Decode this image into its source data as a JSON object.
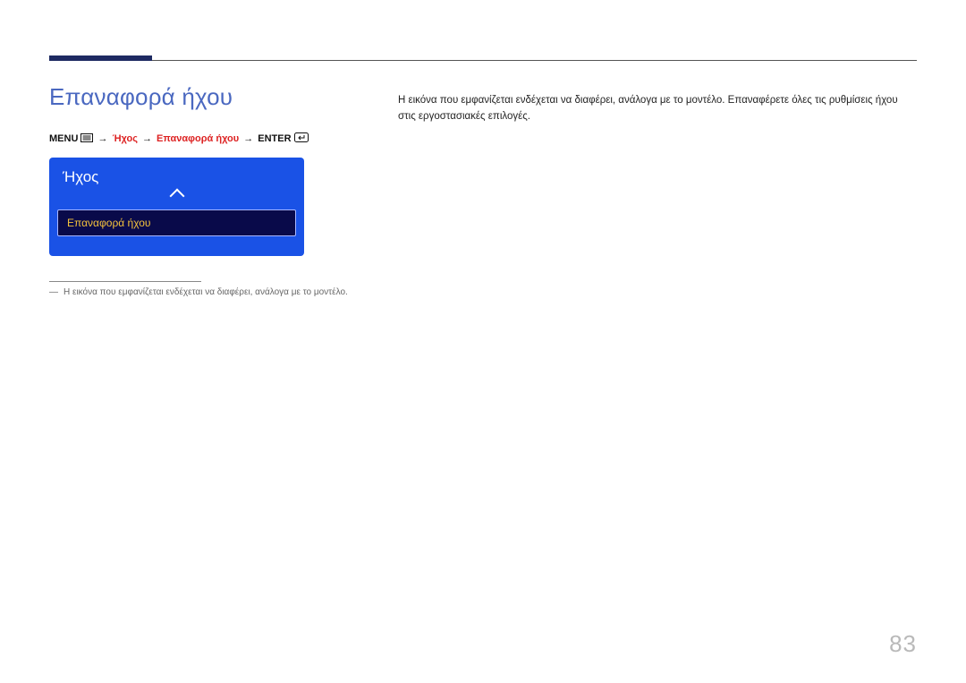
{
  "header": {},
  "section": {
    "title": "Επαναφορά ήχου"
  },
  "breadcrumb": {
    "menu_label": "MENU",
    "step2": "Ήχος",
    "step3": "Επαναφορά ήχου",
    "enter_label": "ENTER"
  },
  "osd": {
    "title": "Ήχος",
    "selected_item": "Επαναφορά ήχου"
  },
  "footnote": {
    "dash": "―",
    "text": "Η εικόνα που εμφανίζεται ενδέχεται να διαφέρει, ανάλογα με το μοντέλο."
  },
  "description": "Η εικόνα που εμφανίζεται ενδέχεται να διαφέρει, ανάλογα με το μοντέλο. Επαναφέρετε όλες τις ρυθμίσεις ήχου στις εργοστασιακές επιλογές.",
  "page_number": "83"
}
